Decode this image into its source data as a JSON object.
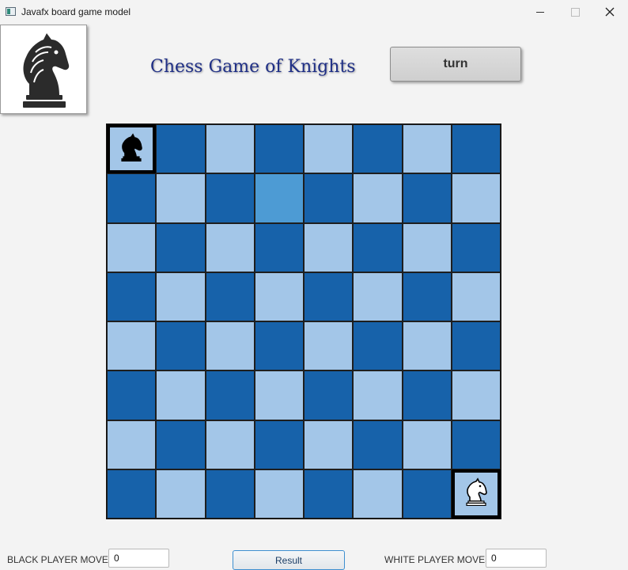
{
  "window": {
    "title": "Javafx board game model"
  },
  "header": {
    "title": "Chess Game of Knights",
    "turn_label": "turn"
  },
  "board": {
    "size": 8,
    "light_color": "#a3c6e8",
    "dark_color": "#1762aa",
    "highlight_color": "#4d9bd4",
    "highlighted_square": {
      "row": 1,
      "col": 3
    },
    "pieces": [
      {
        "row": 0,
        "col": 0,
        "type": "knight",
        "color": "black",
        "selected": true
      },
      {
        "row": 7,
        "col": 7,
        "type": "knight",
        "color": "white",
        "selected": true
      }
    ]
  },
  "footer": {
    "black_label": "BLACK PLAYER MOVES",
    "black_moves": "0",
    "result_label": "Result",
    "white_label": "WHITE PLAYER MOVES",
    "white_moves": "0"
  }
}
